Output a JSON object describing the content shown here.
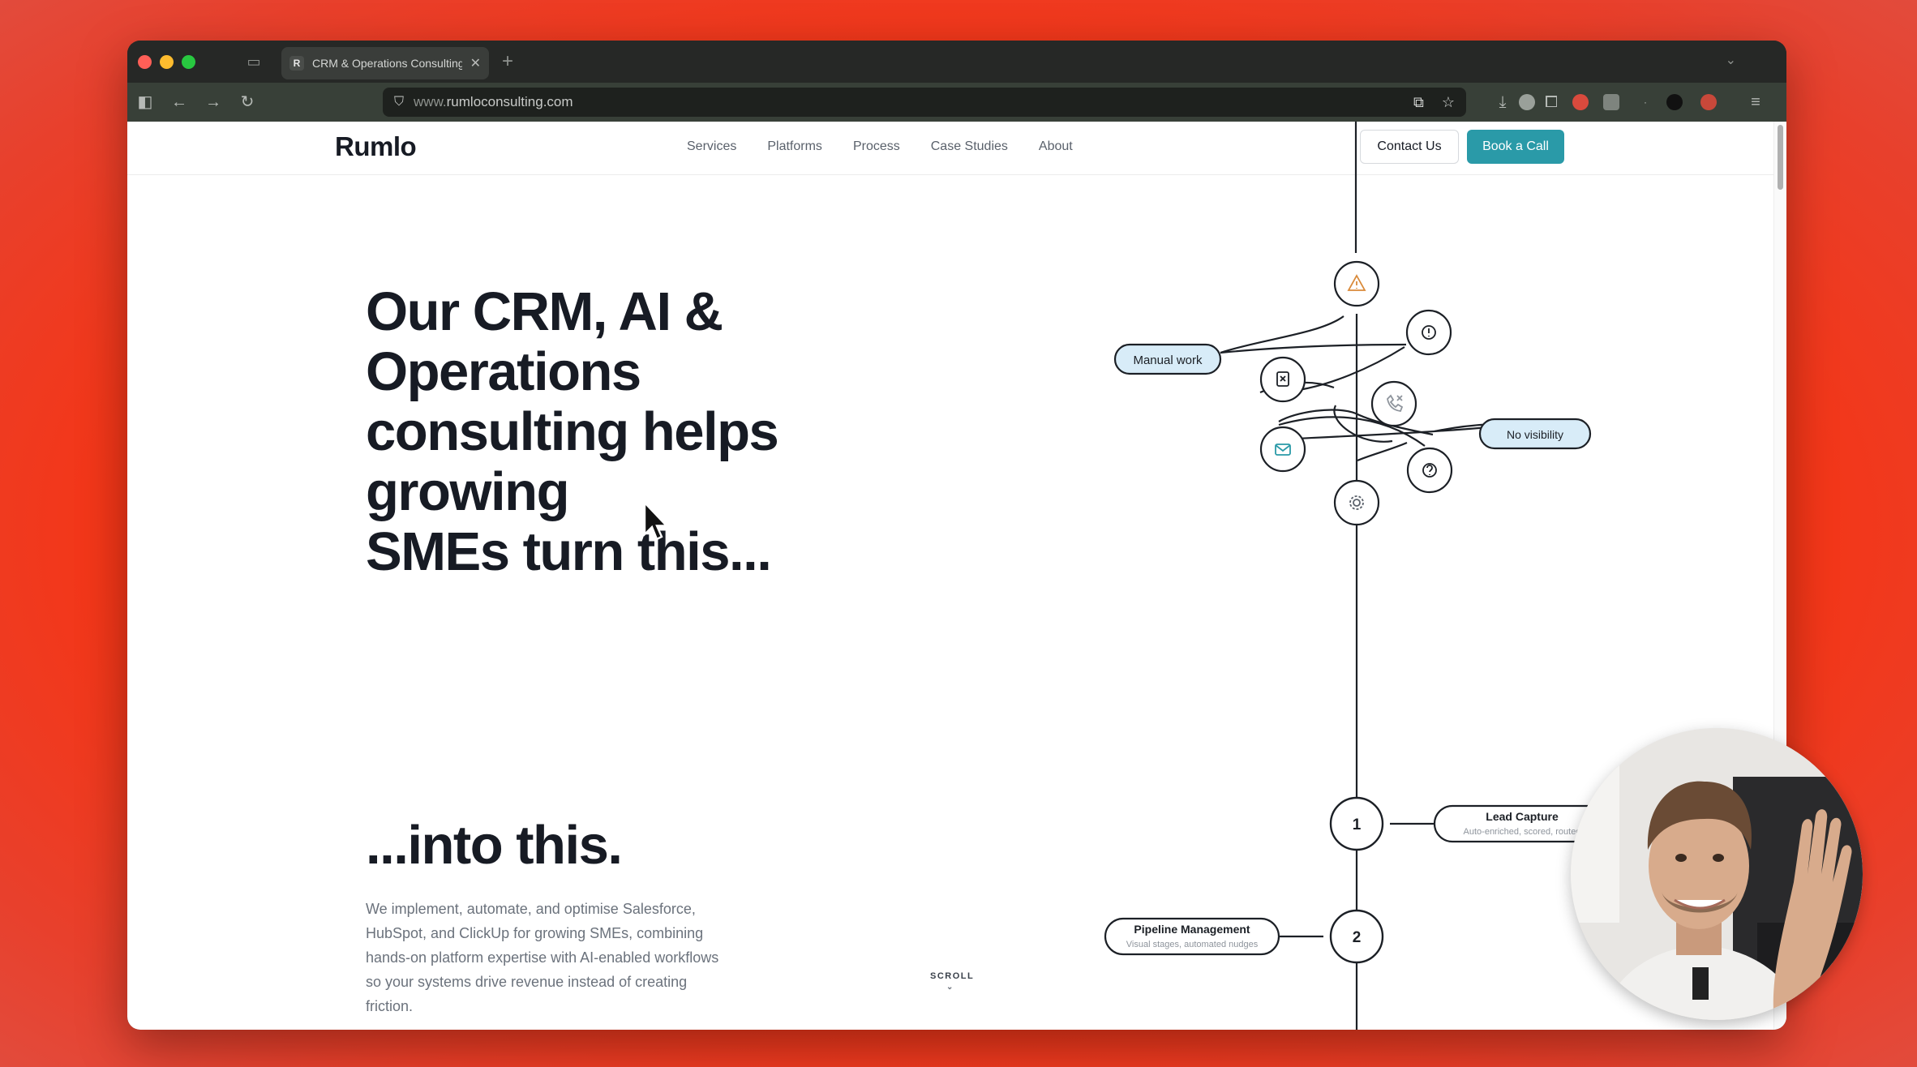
{
  "browser": {
    "tab": {
      "favicon": "R",
      "title": "CRM & Operations Consulting for",
      "close": "✕"
    },
    "new_tab": "+",
    "url": {
      "prefix": "www.",
      "domain": "rumloconsulting.com"
    }
  },
  "site": {
    "logo": "Rumlo",
    "nav": [
      "Services",
      "Platforms",
      "Process",
      "Case Studies",
      "About"
    ],
    "contact_label": "Contact Us",
    "book_label": "Book a Call"
  },
  "hero": {
    "title_lines": [
      "Our CRM, AI &",
      "Operations",
      "consulting helps",
      "growing",
      "SMEs turn this..."
    ],
    "into": "...into this.",
    "description": "We implement, automate, and optimise Salesforce, HubSpot, and ClickUp for growing SMEs, combining hands-on platform expertise with AI-enabled workflows so your systems drive revenue instead of creating friction.",
    "scroll": "SCROLL"
  },
  "diagram": {
    "problem_tags": [
      "Manual work",
      "No visibility"
    ],
    "problem_icons": [
      "warning-icon",
      "alert-icon",
      "clipboard-x-icon",
      "phone-missed-icon",
      "mail-icon",
      "question-icon",
      "gear-icon"
    ],
    "steps": [
      {
        "number": "1",
        "title": "Lead Capture",
        "subtitle": "Auto-enriched, scored, routed"
      },
      {
        "number": "2",
        "title": "Pipeline Management",
        "subtitle": "Visual stages, automated nudges"
      }
    ]
  },
  "colors": {
    "accent": "#2a9aa8",
    "heading": "#171b24",
    "tag_fill": "#d8ecf8",
    "backdrop": "#f83311"
  }
}
